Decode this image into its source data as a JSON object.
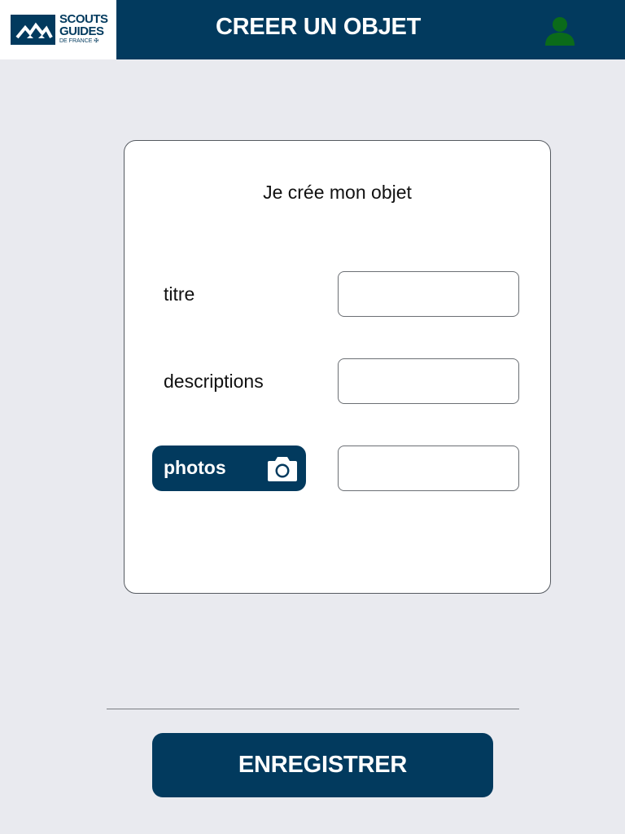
{
  "header": {
    "logo": {
      "line1": "SCOUTS",
      "line2": "GUIDES",
      "line3": "DE FRANCE ✠"
    },
    "title": "CREER UN OBJET",
    "user_icon": "user-icon",
    "user_icon_color": "#0b6b1a"
  },
  "form": {
    "title": "Je crée mon objet",
    "fields": [
      {
        "label": "titre",
        "value": "",
        "placeholder": ""
      },
      {
        "label": "descriptions",
        "value": "",
        "placeholder": ""
      },
      {
        "label": "photos",
        "value": "",
        "placeholder": "",
        "icon": "camera-icon"
      }
    ]
  },
  "footer": {
    "save_label": "ENREGISTRER"
  },
  "colors": {
    "primary": "#023a5e",
    "background": "#e9eaef",
    "card": "#ffffff"
  }
}
